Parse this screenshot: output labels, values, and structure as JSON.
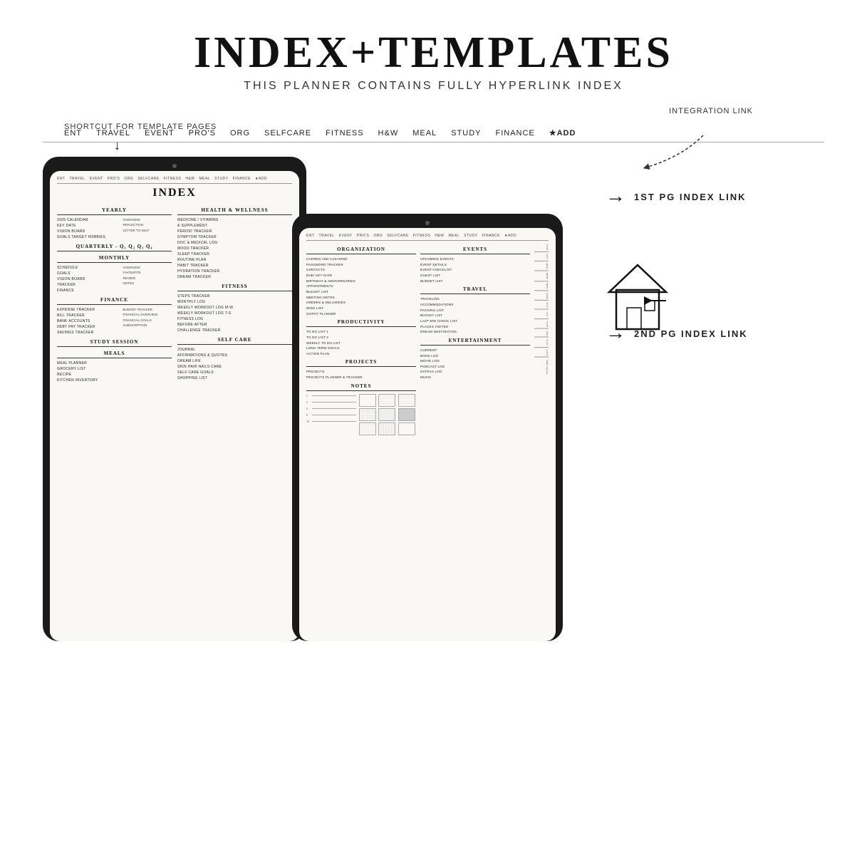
{
  "header": {
    "main_title": "INDEX+TEMPLATES",
    "subtitle": "THIS PLANNER CONTAINS FULLY HYPERLINK INDEX"
  },
  "shortcut_label": "SHORTCUT FOR TEMPLATE PAGES",
  "integration_label": "INTEGRATION LINK",
  "tab_bar": {
    "items": [
      "ENT",
      "TRAVEL",
      "EVENT",
      "PRO'S",
      "ORG",
      "SELFCARE",
      "FITNESS",
      "H&W",
      "MEAL",
      "STUDY",
      "FINANCE",
      "★ADD"
    ]
  },
  "right_labels": {
    "first_pg": "1ST PG INDEX LINK",
    "second_pg": "2ND PG INDEX LINK"
  },
  "tablet1": {
    "title": "INDEX",
    "left_col": {
      "yearly": {
        "title": "YEARLY",
        "items": [
          "2025 CALENDAR",
          "KEY DATE",
          "VISION BOARD",
          "GOALS TARGET HOBBIES"
        ],
        "subitems": [
          "OVERVIEW",
          "REFLECTION",
          "LETTER TO SELF"
        ]
      },
      "quarterly": {
        "title": "QUARTERLY -",
        "quarters": "Q1  Q2  Q3  Q4"
      },
      "monthly": {
        "title": "MONTHLY",
        "items": [
          "SCHEDULE",
          "GOALS",
          "VISION BOARD",
          "TRACKER",
          "FINANCE"
        ],
        "subitems": [
          "OVERVIEW",
          "FAVOURITE",
          "REVIEW",
          "NOTES"
        ]
      },
      "finance": {
        "title": "FINANCE",
        "items": [
          "EXPENSE TRACKER",
          "BILL TRACKER",
          "BANK ACCOUNTS",
          "DEBT PAY TRACKER",
          "SAVINGS TRACKER"
        ],
        "subitems": [
          "BUDGET TRACKER",
          "FINANCIAL OVERVIEW",
          "FINANCIAL GOALS",
          "SUBSCRIPTION"
        ]
      },
      "study": {
        "title": "STUDY SESSION"
      },
      "meals": {
        "title": "MEALS",
        "items": [
          "MEAL PLANNER",
          "GROCERY LIST",
          "RECIPE",
          "KITCHEN INVENTORY"
        ]
      }
    },
    "right_col": {
      "health": {
        "title": "HEALTH & WELLNESS",
        "items": [
          "MEDICINE / VITAMINS",
          "& SUPPLEMENT",
          "PERIOD TRACKER",
          "SYMPTOM TRACKER",
          "DOC & MEDICAL LOG",
          "MOOD TRACKER",
          "SLEEP TRACKER",
          "ROUTINE PLAN",
          "HABIT TRACKER",
          "HYDRATION TRACKER",
          "DREAM TRACKER"
        ]
      },
      "fitness": {
        "title": "FITNESS",
        "items": [
          "STEPS TRACKER",
          "MONTHLY LOG",
          "WEEKLY WORKOUT LOG M-W",
          "WEEKLY WORKOUT LOG T-S",
          "FITNESS LOG",
          "BEFORE AFTER",
          "CHALLENGE TRACKER"
        ]
      },
      "selfcare": {
        "title": "SELF CARE",
        "items": [
          "JOURNAL",
          "AFFIRMATIONS & QUOTES",
          "DREAM LIFE",
          "SKIN HAIR NAILS CARE",
          "SELF CARE GOALS",
          "SHOPPING LIST"
        ]
      }
    }
  },
  "tablet2": {
    "left_col": {
      "organization": {
        "title": "ORGANIZATION",
        "items": [
          "CHORES AND CLEANING",
          "PASSWORD TRACKER",
          "CONTACTS",
          "DUE/ KEY DATE",
          "BIRTHDAY & ANNIVERSARIES",
          "APPOINTMENTS",
          "BUCKET LIST",
          "MEETING NOTES",
          "ORDERS & DELIVERIES",
          "WISH LIST",
          "OUTFIT PLANNER"
        ]
      },
      "productivity": {
        "title": "PRODUCTIVITY",
        "items": [
          "TO DO LIST 1",
          "TO DO LIST 2",
          "WEEKLY TO DO LIST",
          "LONG TERM GOALS",
          "ACTION PLAN"
        ]
      },
      "projects": {
        "title": "PROJECTS",
        "items": [
          "PROJECTS",
          "PROJECTS PLANNER & TRACKER"
        ]
      },
      "notes": {
        "title": "NOTES",
        "numbers": [
          "2",
          "4",
          "6",
          "8",
          "10"
        ]
      }
    },
    "right_col": {
      "events": {
        "title": "EVENTS",
        "items": [
          "UPCOMING EVENTS",
          "EVENT DETAILS",
          "EVENT CHECKLIST",
          "GUEST LIST",
          "BUDGET LIST"
        ]
      },
      "travel": {
        "title": "TRAVEL",
        "items": [
          "TRAVELING",
          "ACCOMMODATIONS",
          "PACKING LIST",
          "BUCKET LIST",
          "LAST MIN CHECK LIST",
          "PLACES VISITED",
          "DREAM DESTINATION"
        ]
      },
      "entertainment": {
        "title": "ENTERTAINMENT",
        "items": [
          "CURRENT",
          "BOOK LOG",
          "MOVIE LOG",
          "PODCAST LOG",
          "EXTRAS LOG",
          "MUSIC"
        ]
      }
    },
    "side_months": [
      "2025",
      "JAN",
      "FEB",
      "MAR",
      "APR",
      "MAY",
      "JUN",
      "JUL",
      "AUG",
      "SEP",
      "OCT",
      "NOV",
      "DEC",
      "NOTES"
    ]
  }
}
